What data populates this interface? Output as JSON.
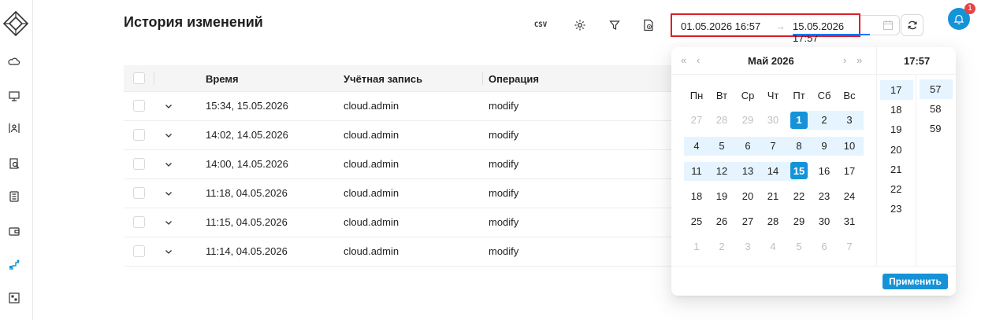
{
  "page": {
    "title": "История изменений"
  },
  "toolbar": {
    "csv_label": "CSV"
  },
  "range": {
    "from": "01.05.2026 16:57",
    "separator": "→",
    "to": "15.05.2026 17:57"
  },
  "notifications": {
    "count": "1"
  },
  "table": {
    "headers": [
      "Время",
      "Учётная запись",
      "Операция"
    ],
    "rows": [
      {
        "time": "15:34, 15.05.2026",
        "account": "cloud.admin",
        "operation": "modify"
      },
      {
        "time": "14:02, 14.05.2026",
        "account": "cloud.admin",
        "operation": "modify"
      },
      {
        "time": "14:00, 14.05.2026",
        "account": "cloud.admin",
        "operation": "modify"
      },
      {
        "time": "11:18, 04.05.2026",
        "account": "cloud.admin",
        "operation": "modify"
      },
      {
        "time": "11:15, 04.05.2026",
        "account": "cloud.admin",
        "operation": "modify"
      },
      {
        "time": "11:14, 04.05.2026",
        "account": "cloud.admin",
        "operation": "modify"
      }
    ]
  },
  "calendar": {
    "month_label": "Май  2026",
    "time_label": "17:57",
    "weekdays": [
      "Пн",
      "Вт",
      "Ср",
      "Чт",
      "Пт",
      "Сб",
      "Вс"
    ],
    "weeks": [
      [
        "27",
        "28",
        "29",
        "30",
        "1",
        "2",
        "3"
      ],
      [
        "4",
        "5",
        "6",
        "7",
        "8",
        "9",
        "10"
      ],
      [
        "11",
        "12",
        "13",
        "14",
        "15",
        "16",
        "17"
      ],
      [
        "18",
        "19",
        "20",
        "21",
        "22",
        "23",
        "24"
      ],
      [
        "25",
        "26",
        "27",
        "28",
        "29",
        "30",
        "31"
      ],
      [
        "1",
        "2",
        "3",
        "4",
        "5",
        "6",
        "7"
      ]
    ],
    "hours": [
      "17",
      "18",
      "19",
      "20",
      "21",
      "22",
      "23"
    ],
    "minutes": [
      "57",
      "58",
      "59"
    ],
    "apply_label": "Применить"
  },
  "colors": {
    "accent": "#1593d8",
    "range_bg": "#e6f4ff",
    "highlight_border": "#d9202c",
    "badge": "#e64545"
  }
}
